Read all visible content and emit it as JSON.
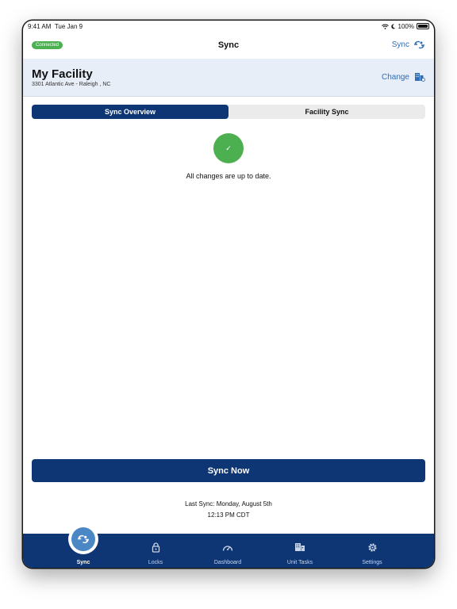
{
  "status_bar": {
    "time": "9:41 AM",
    "date": "Tue Jan 9",
    "battery": "100%"
  },
  "nav": {
    "badge": "Connected",
    "title": "Sync",
    "sync_label": "Sync"
  },
  "facility": {
    "name": "My Facility",
    "address": "3301 Atlantic Ave - Raleigh , NC",
    "change_label": "Change"
  },
  "segments": [
    {
      "label": "Sync Overview",
      "active": true
    },
    {
      "label": "Facility Sync",
      "active": false
    }
  ],
  "overview": {
    "check": "✓",
    "message": "All changes are up to date."
  },
  "sync_now": "Sync Now",
  "last_sync": {
    "line1": "Last Sync: Monday, August 5th",
    "line2": "12:13 PM CDT"
  },
  "tabs": [
    {
      "label": "Sync",
      "icon": "sync-icon",
      "active": true
    },
    {
      "label": "Locks",
      "icon": "lock-icon",
      "active": false
    },
    {
      "label": "Dashboard",
      "icon": "gauge-icon",
      "active": false
    },
    {
      "label": "Unit Tasks",
      "icon": "building-icon",
      "active": false
    },
    {
      "label": "Settings",
      "icon": "gear-icon",
      "active": false
    }
  ],
  "colors": {
    "primary": "#0e3574",
    "accent": "#2f6db5",
    "success": "#4caf50",
    "header_bg": "#e8eef7"
  }
}
